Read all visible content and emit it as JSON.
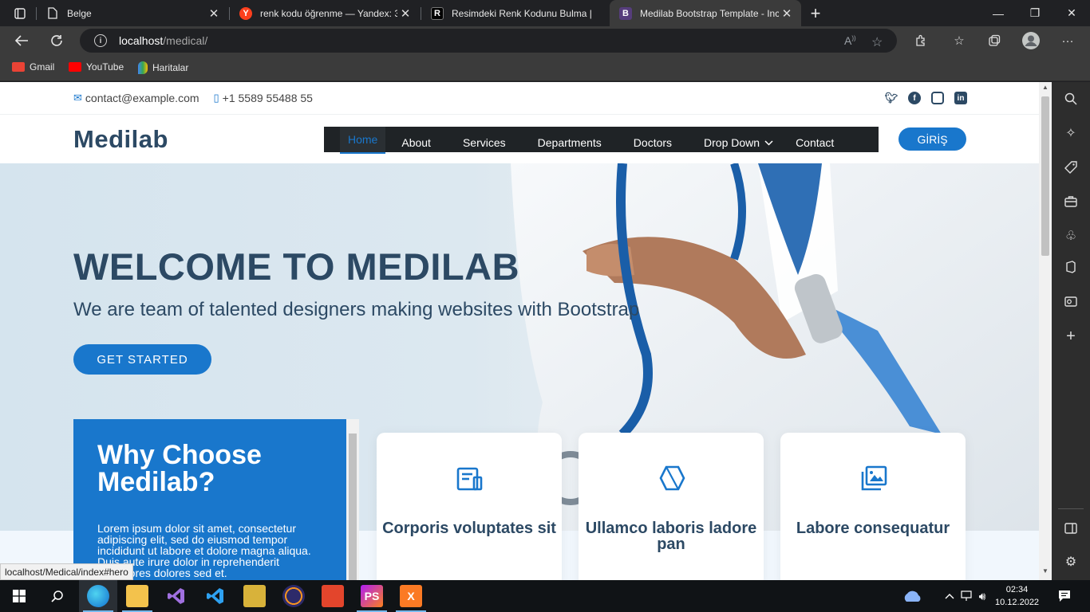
{
  "browser": {
    "tabs": [
      {
        "title": "Belge",
        "icon": "document-icon",
        "active": false
      },
      {
        "title": "renk kodu öğrenme — Yandex: 3",
        "icon": "yandex-icon",
        "active": false
      },
      {
        "title": "Resimdeki Renk Kodunu Bulma |",
        "icon": "site-icon",
        "active": false
      },
      {
        "title": "Medilab Bootstrap Template - Inc",
        "icon": "bootstrap-icon",
        "active": true
      }
    ],
    "address": {
      "host": "localhost",
      "path": "/medical/"
    },
    "bookmarks": [
      {
        "label": "Gmail",
        "icon": "gmail-icon",
        "color": "#ea4335"
      },
      {
        "label": "YouTube",
        "icon": "youtube-icon",
        "color": "#ff0000"
      },
      {
        "label": "Haritalar",
        "icon": "maps-icon",
        "color": "#34a853"
      }
    ],
    "status_url": "localhost/Medical/index#hero",
    "tab_favicon_letters": {
      "yandex": "Y",
      "site": "R",
      "bootstrap": "B"
    }
  },
  "site": {
    "topbar": {
      "email": "contact@example.com",
      "phone": "+1 5589 55488 55",
      "social": [
        "twitter-icon",
        "facebook-icon",
        "instagram-icon",
        "linkedin-icon"
      ]
    },
    "logo": "Medilab",
    "nav": [
      "Home",
      "About",
      "Services",
      "Departments",
      "Doctors",
      "Drop Down",
      "Contact"
    ],
    "nav_active": "Home",
    "dropdown_arrow": "⌄",
    "login": "GİRİŞ",
    "hero": {
      "title": "WELCOME TO MEDILAB",
      "subtitle": "We are team of talented designers making websites with Bootstrap",
      "cta": "GET STARTED"
    },
    "why": {
      "title": "Why Choose Medilab?",
      "text": "Lorem ipsum dolor sit amet, consectetur adipiscing elit, sed do eiusmod tempor incididunt ut labore et dolore magna aliqua. Duis aute irure dolor in reprehenderit Asperiores dolores sed et."
    },
    "cards": [
      {
        "title": "Corporis voluptates sit",
        "icon": "receipt-icon"
      },
      {
        "title": "Ullamco laboris ladore pan",
        "icon": "cube-icon"
      },
      {
        "title": "Labore consequatur",
        "icon": "images-icon"
      }
    ]
  },
  "taskbar": {
    "time": "02:34",
    "date": "10.12.2022",
    "apps": [
      "start-icon",
      "search-icon",
      "edge-icon",
      "explorer-icon",
      "visual-studio-icon",
      "vscode-icon",
      "tool-icon",
      "eclipse-icon",
      "office-icon",
      "phpstorm-icon",
      "xampp-icon"
    ],
    "labels": {
      "phpstorm": "PS",
      "xampp": "X"
    }
  },
  "colors": {
    "accent": "#1977cc",
    "heading": "#2c4964",
    "nav_bg": "#1f2326"
  }
}
